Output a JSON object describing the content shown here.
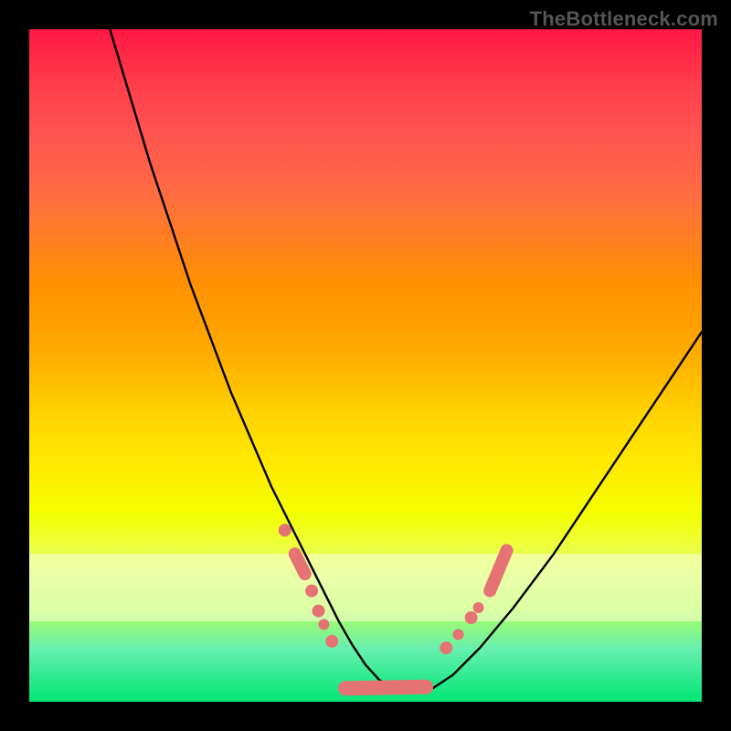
{
  "watermark": {
    "text": "TheBottleneck.com"
  },
  "chart_data": {
    "type": "line",
    "title": "",
    "xlabel": "",
    "ylabel": "",
    "xlim": [
      0,
      100
    ],
    "ylim": [
      0,
      100
    ],
    "series": [
      {
        "name": "bottleneck-curve",
        "x": [
          12,
          15,
          18,
          21,
          24,
          27,
          30,
          33,
          36,
          38,
          40,
          42,
          44,
          46,
          48,
          50,
          52,
          54,
          56,
          58,
          60,
          63,
          67,
          72,
          78,
          84,
          90,
          96,
          100
        ],
        "y": [
          100,
          90,
          80,
          71,
          62,
          54,
          46,
          39,
          32,
          28,
          24,
          20,
          16,
          12,
          8.5,
          5.5,
          3.3,
          2,
          1.5,
          1.5,
          2,
          4,
          8,
          14,
          22,
          31,
          40,
          49,
          55
        ]
      }
    ],
    "markers": {
      "left_cluster": {
        "x": [
          38.0,
          39.5,
          41.0,
          42.0,
          43.0,
          43.8,
          45.0
        ],
        "y": [
          25.5,
          22.0,
          19.0,
          16.5,
          13.5,
          11.5,
          9.0
        ]
      },
      "valley_cluster": {
        "x": [
          47,
          49,
          51,
          53,
          55,
          57,
          59
        ],
        "y": [
          2.0,
          1.7,
          1.5,
          1.5,
          1.6,
          1.8,
          2.2
        ]
      },
      "right_cluster": {
        "x": [
          62.0,
          63.8,
          65.7,
          66.8,
          68.5,
          71.0
        ],
        "y": [
          8.0,
          10.0,
          12.5,
          14.0,
          16.5,
          22.5
        ]
      }
    },
    "zones": {
      "pale_yellow_band": {
        "y_from": 12,
        "y_to": 22
      }
    },
    "colors": {
      "curve": "#000000",
      "marker_fill": "#e57373",
      "marker_pill_fill": "#e57373"
    }
  }
}
